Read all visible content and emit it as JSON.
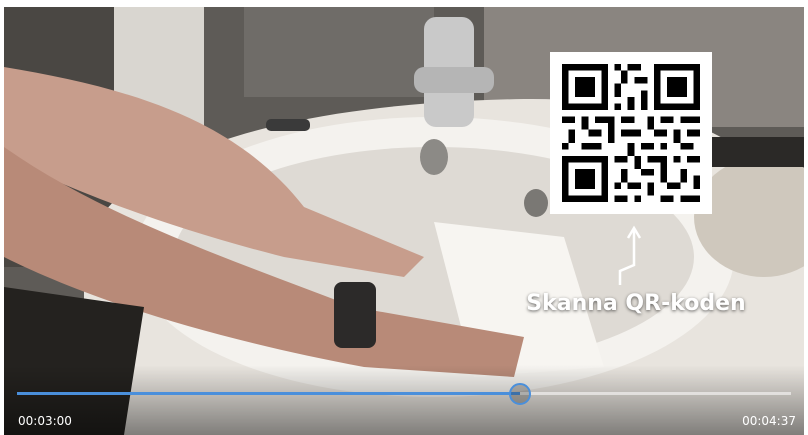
{
  "overlay": {
    "caption": "Skanna QR-koden",
    "qr_icon": "qr-code-icon",
    "arrow_icon": "arrow-up-icon"
  },
  "player": {
    "current_time": "00:03:00",
    "total_time": "00:04:37",
    "progress_fraction": 0.65,
    "accent_color": "#4a8fdb"
  }
}
